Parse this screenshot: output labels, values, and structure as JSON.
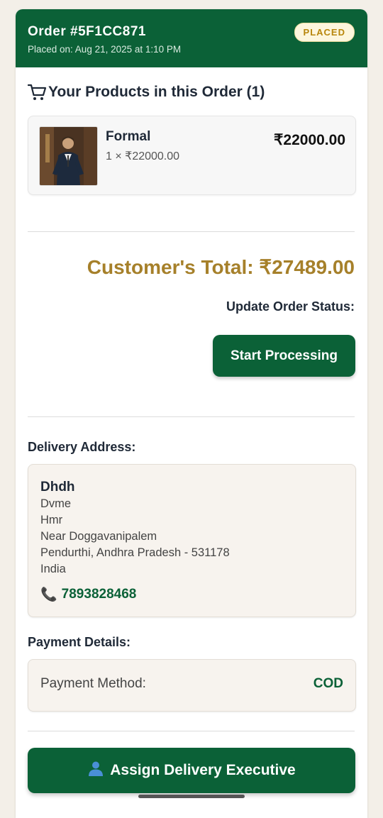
{
  "order": {
    "id_label": "Order #5F1CC871",
    "placed_on": "Placed on: Aug 21, 2025 at 1:10 PM",
    "status_badge": "PLACED"
  },
  "products": {
    "title": "Your Products in this Order (1)",
    "items": [
      {
        "name": "Formal",
        "qty_price": "1 × ₹22000.00",
        "line_total": "₹22000.00"
      }
    ]
  },
  "total": {
    "label": "Customer's Total: ₹27489.00"
  },
  "status_update": {
    "label": "Update Order Status:",
    "button_label": "Start Processing"
  },
  "delivery": {
    "label": "Delivery Address:",
    "name": "Dhdh",
    "lines": [
      "Dvme",
      "Hmr",
      "Near Doggavanipalem",
      "Pendurthi, Andhra Pradesh - 531178",
      "India"
    ],
    "phone": "7893828468"
  },
  "payment": {
    "label": "Payment Details:",
    "method_label": "Payment Method:",
    "method_value": "COD"
  },
  "assign": {
    "button_label": "Assign Delivery Executive"
  },
  "colors": {
    "primary": "#0b6137",
    "accent_gold": "#a6802a",
    "badge_bg": "#fdf6dd"
  }
}
